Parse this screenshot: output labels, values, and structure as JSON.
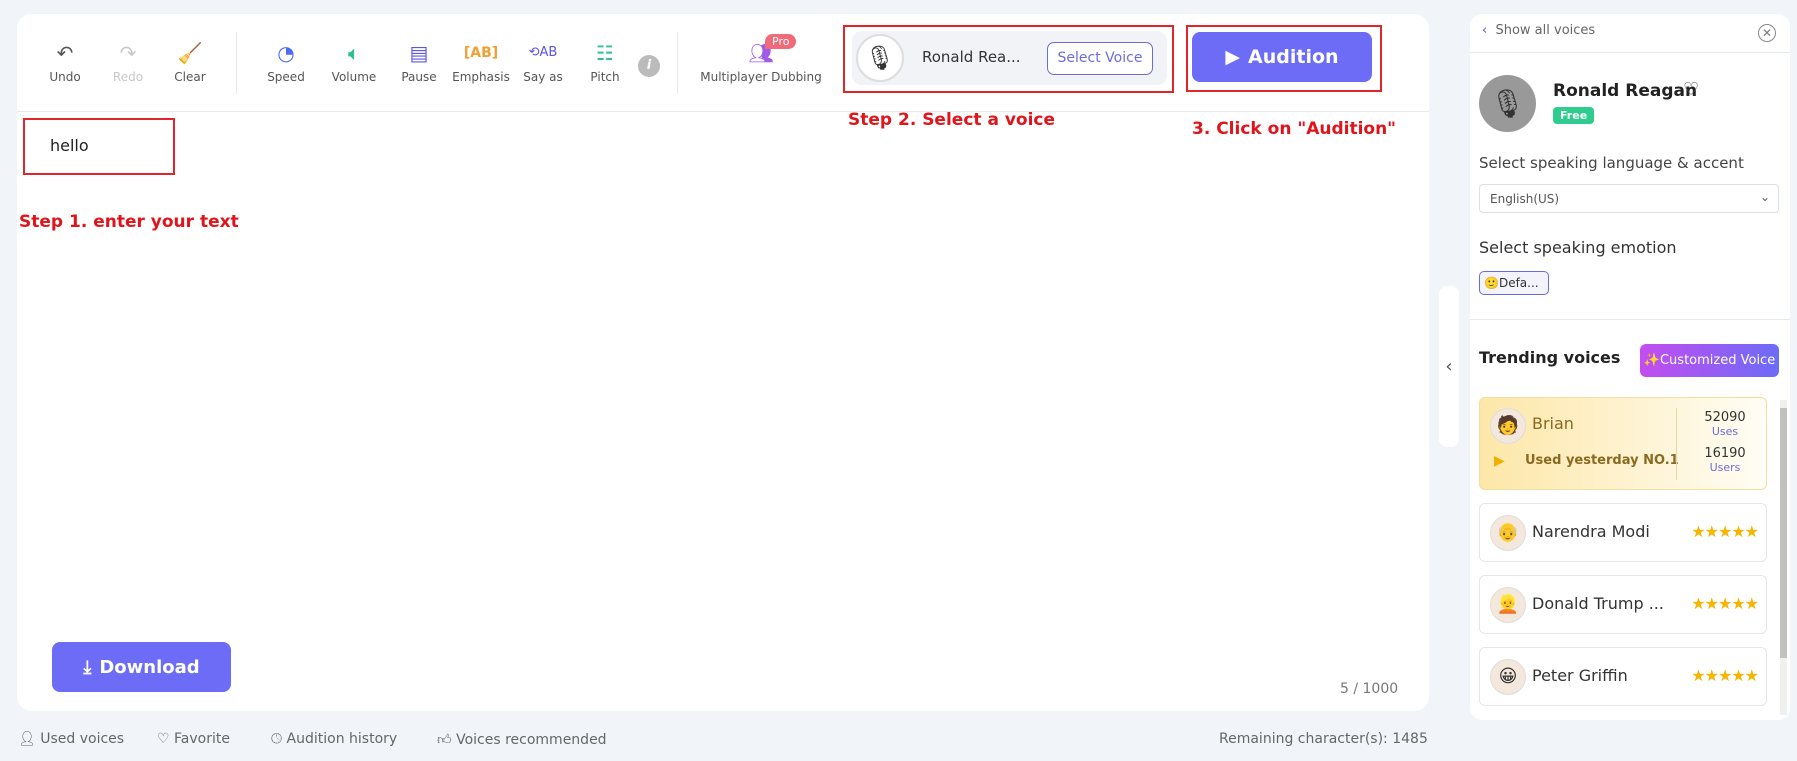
{
  "toolbar": {
    "undo": "Undo",
    "redo": "Redo",
    "clear": "Clear",
    "speed": "Speed",
    "volume": "Volume",
    "pause": "Pause",
    "emphasis": "Emphasis",
    "say_as": "Say as",
    "pitch": "Pitch",
    "multiplayer": "Multiplayer Dubbing",
    "pro_badge": "Pro"
  },
  "voice_selector": {
    "name": "Ronald Rea...",
    "select_label": "Select Voice"
  },
  "audition_label": "Audition",
  "editor": {
    "text": "hello",
    "count": "5 / 1000"
  },
  "annotations": {
    "step1": "Step 1. enter your text",
    "step2": "Step 2. Select a voice",
    "step3": "3. Click on \"Audition\""
  },
  "download_label": "Download",
  "footer": {
    "used_voices": "Used voices",
    "favorite": "Favorite",
    "audition_history": "Audition history",
    "voices_recommended": "Voices recommended",
    "remaining": "Remaining character(s): 1485"
  },
  "panel": {
    "back_label": "Show all voices",
    "voice_name": "Ronald Reagan",
    "free_badge": "Free",
    "language_label": "Select speaking language & accent",
    "language_value": "English(US)",
    "emotion_label": "Select speaking emotion",
    "emotion_value": "Defa...",
    "trending_title": "Trending voices",
    "customized_label": "Customized Voice",
    "top_voice": {
      "name": "Brian",
      "rank": "Used yesterday NO.1",
      "uses": "52090",
      "uses_label": "Uses",
      "users": "16190",
      "users_label": "Users"
    },
    "voices": [
      {
        "name": "Narendra Modi",
        "rating": 5
      },
      {
        "name": "Donald Trump ...",
        "rating": 5
      },
      {
        "name": "Peter Griffin",
        "rating": 5
      }
    ]
  },
  "colors": {
    "accent": "#6c6cf7",
    "annotation": "#e0141b",
    "free": "#2ecc8f",
    "pro": "#f06a7a"
  }
}
